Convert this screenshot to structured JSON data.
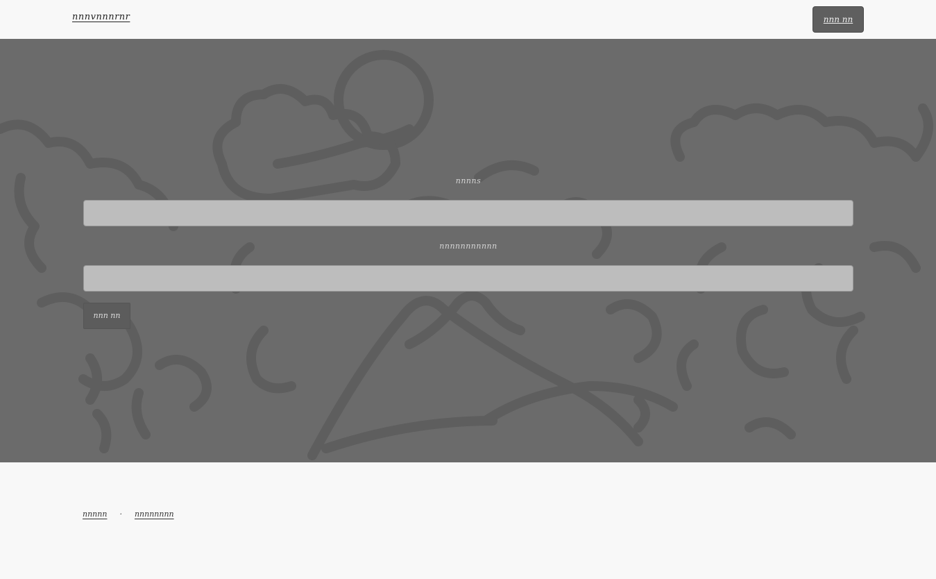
{
  "header": {
    "brand": "nnnvnnnrnr",
    "button_label": "nnn nn"
  },
  "form": {
    "field1_label": "nnnns",
    "field1_value": "",
    "field2_label": "nnnnnnnnnnn",
    "field2_value": "",
    "submit_label": "nnn nn"
  },
  "footer": {
    "link1": "nnnnn",
    "separator": "·",
    "link2": "nnnnnnnn"
  },
  "colors": {
    "hero_bg": "#6b6b6b",
    "button_bg": "#5f5f5f",
    "page_bg": "#f8f8f8"
  }
}
